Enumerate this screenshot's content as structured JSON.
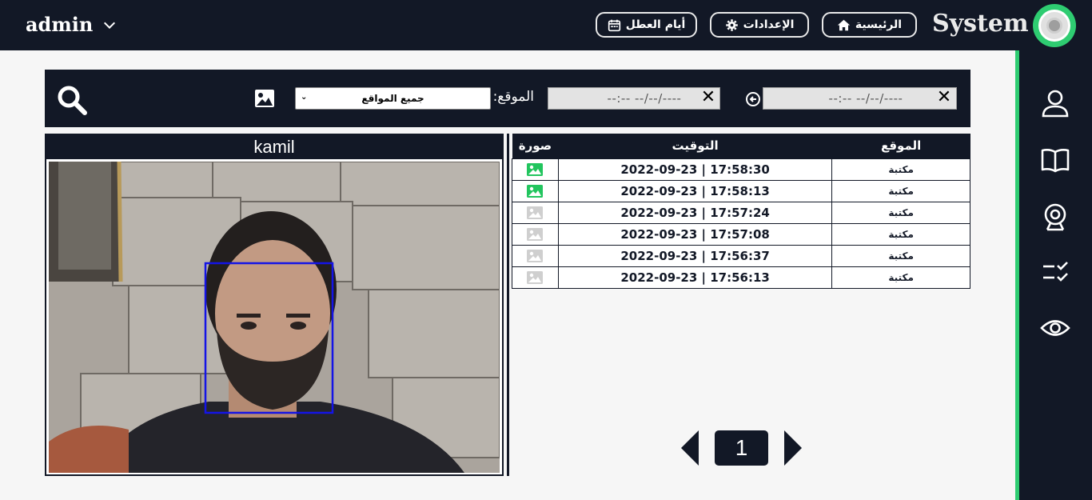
{
  "header": {
    "user": "admin",
    "brand": "System",
    "nav": {
      "home": "الرئيسية",
      "settings": "الإعدادات",
      "holidays": "أيام العطل"
    },
    "accent": "#2ecc71",
    "dark": "#121826"
  },
  "sidebar": {
    "items": [
      "user-icon",
      "book-icon",
      "webcam-icon",
      "checklist-icon",
      "eye-icon"
    ]
  },
  "filters": {
    "date_from": "--:-- --/--/----",
    "date_to": "--:-- --/--/----",
    "site_label": "الموقع:",
    "site_selected": "جميع المواقع"
  },
  "person": {
    "name": "kamil"
  },
  "table": {
    "headers": {
      "place": "الموقع",
      "time": "التوقيت",
      "image": "صورة"
    },
    "rows": [
      {
        "place": "مكتبة",
        "time": "2022-09-23 | 17:58:30",
        "has_image": true
      },
      {
        "place": "مكتبة",
        "time": "2022-09-23 | 17:58:13",
        "has_image": true
      },
      {
        "place": "مكتبة",
        "time": "2022-09-23 | 17:57:24",
        "has_image": false
      },
      {
        "place": "مكتبة",
        "time": "2022-09-23 | 17:57:08",
        "has_image": false
      },
      {
        "place": "مكتبة",
        "time": "2022-09-23 | 17:56:37",
        "has_image": false
      },
      {
        "place": "مكتبة",
        "time": "2022-09-23 | 17:56:13",
        "has_image": false
      }
    ]
  },
  "pagination": {
    "current": "1"
  }
}
